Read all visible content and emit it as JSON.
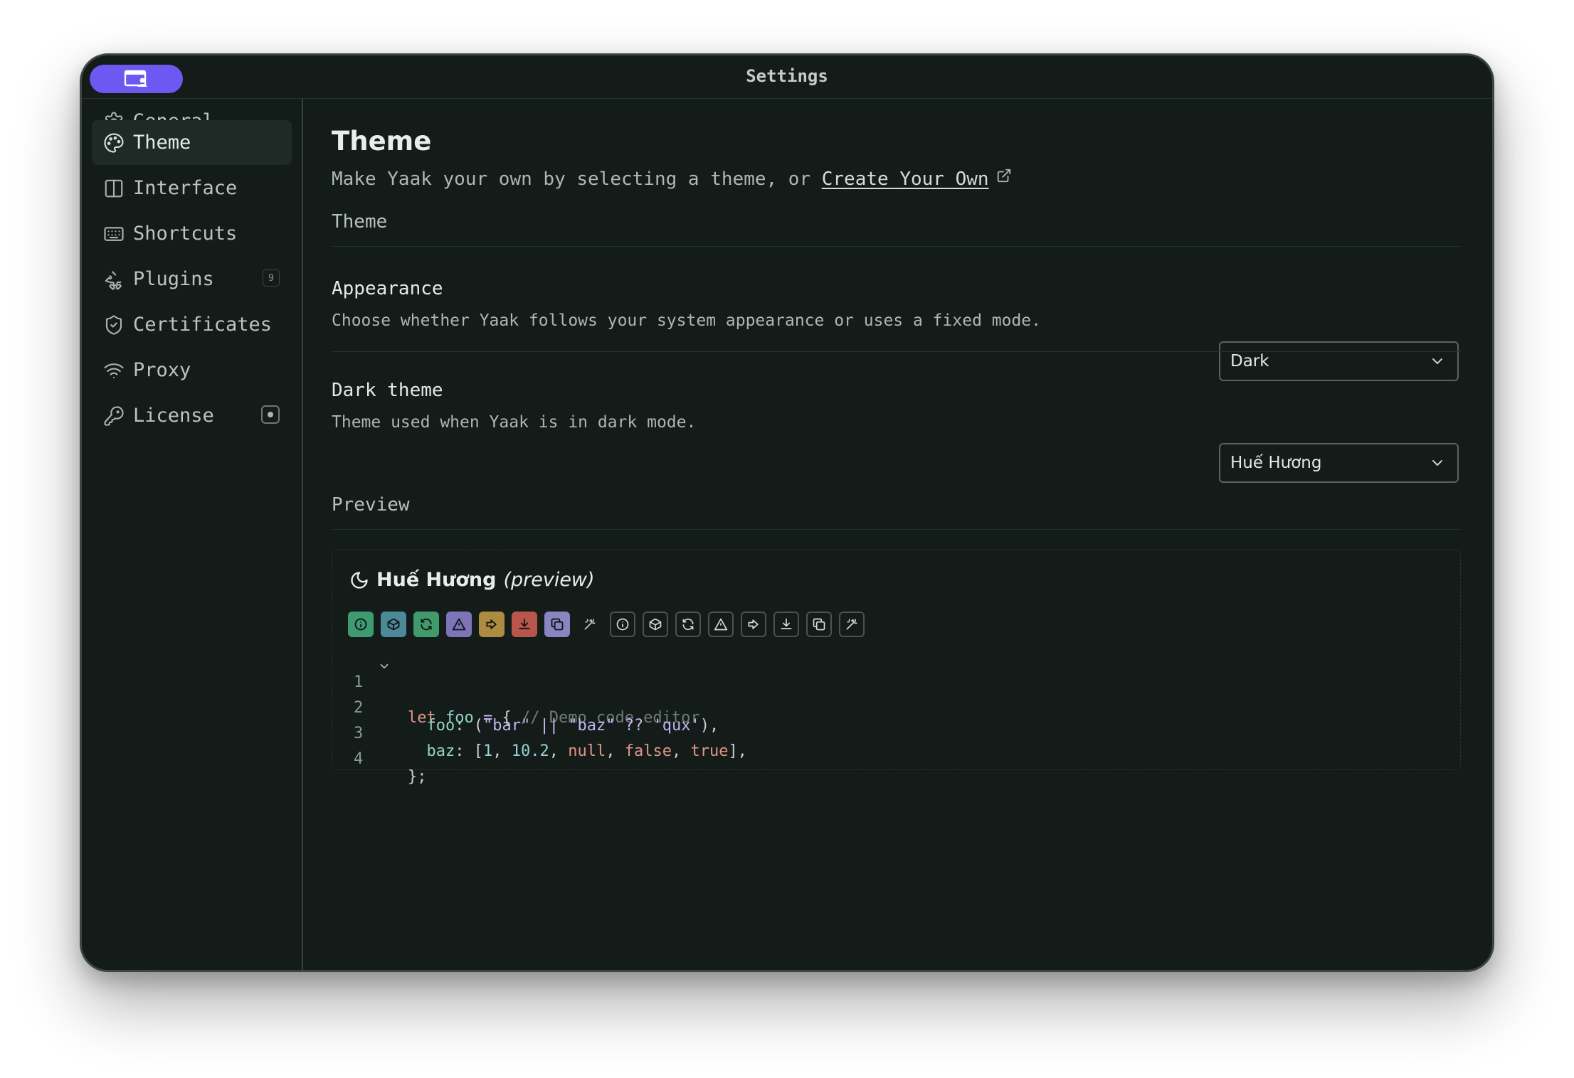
{
  "window": {
    "title": "Settings"
  },
  "sidebar": {
    "items": [
      {
        "label": "General",
        "icon": "gear-icon"
      },
      {
        "label": "Theme",
        "icon": "palette-icon",
        "active": true
      },
      {
        "label": "Interface",
        "icon": "layout-icon"
      },
      {
        "label": "Shortcuts",
        "icon": "keyboard-icon"
      },
      {
        "label": "Plugins",
        "icon": "puzzle-icon",
        "badge": "9"
      },
      {
        "label": "Certificates",
        "icon": "shield-icon"
      },
      {
        "label": "Proxy",
        "icon": "wifi-icon"
      },
      {
        "label": "License",
        "icon": "key-icon"
      }
    ]
  },
  "main": {
    "title": "Theme",
    "subtitle_prefix": "Make Yaak your own by selecting a theme, or ",
    "subtitle_link": "Create Your Own",
    "section_theme": "Theme",
    "appearance": {
      "label": "Appearance",
      "description": "Choose whether Yaak follows your system appearance or uses a fixed mode.",
      "value": "Dark"
    },
    "dark_theme": {
      "label": "Dark theme",
      "description": "Theme used when Yaak is in dark mode.",
      "value": "Huế Hương"
    },
    "section_preview": "Preview",
    "preview": {
      "name": "Huế Hương",
      "suffix": "(preview)",
      "code": {
        "line_numbers": [
          "1",
          "2",
          "3",
          "4"
        ],
        "l1_kw": "let",
        "l1_var": "foo",
        "l1_op": "=",
        "l1_brace": "{",
        "l1_comment": "// Demo code editor",
        "l2_prop": "foo",
        "l2_str1": "\"bar\"",
        "l2_or": "||",
        "l2_str2": "\"baz\"",
        "l2_nc": "??",
        "l2_str3": "'qux'",
        "l3_prop": "baz",
        "l3_n1": "1",
        "l3_n2": "10.2",
        "l3_null": "null",
        "l3_false": "false",
        "l3_true": "true",
        "l4_close": "};"
      }
    }
  },
  "colors": {
    "accent": "#6d58f2",
    "background": "#141c1a",
    "success": "#3e9a70",
    "info": "#4c8a9a",
    "notice": "#7e74b9",
    "warning": "#ad8c42",
    "danger": "#b8564c"
  }
}
